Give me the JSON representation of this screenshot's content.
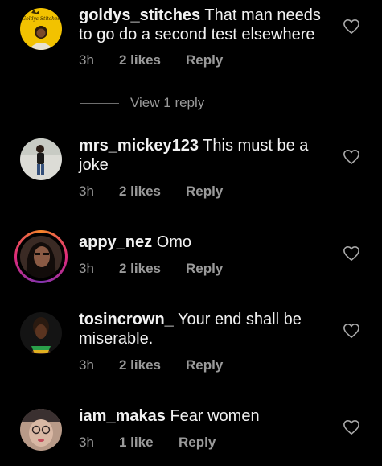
{
  "comments": [
    {
      "username": "goldys_stitches",
      "text": "That man needs to go do a second test elsewhere",
      "time": "3h",
      "likes": "2 likes",
      "reply": "Reply",
      "avatar_label": "Goldys Stitches"
    },
    {
      "username": "mrs_mickey123",
      "text": "This must be a joke",
      "time": "3h",
      "likes": "2 likes",
      "reply": "Reply"
    },
    {
      "username": "appy_nez",
      "text": "Omo",
      "time": "3h",
      "likes": "2 likes",
      "reply": "Reply"
    },
    {
      "username": "tosincrown_",
      "text": "Your end shall be miserable.",
      "time": "3h",
      "likes": "2 likes",
      "reply": "Reply"
    },
    {
      "username": "iam_makas",
      "text": "Fear women",
      "time": "3h",
      "likes": "1 like",
      "reply": "Reply"
    }
  ],
  "view_replies": "View 1 reply",
  "icons": {
    "like": "heart-outline-icon"
  },
  "colors": {
    "background": "#000000",
    "text": "#f2f2f2",
    "muted": "#9a9a9a",
    "story_ring": [
      "#f58529",
      "#dd2a7b",
      "#8134af"
    ]
  }
}
